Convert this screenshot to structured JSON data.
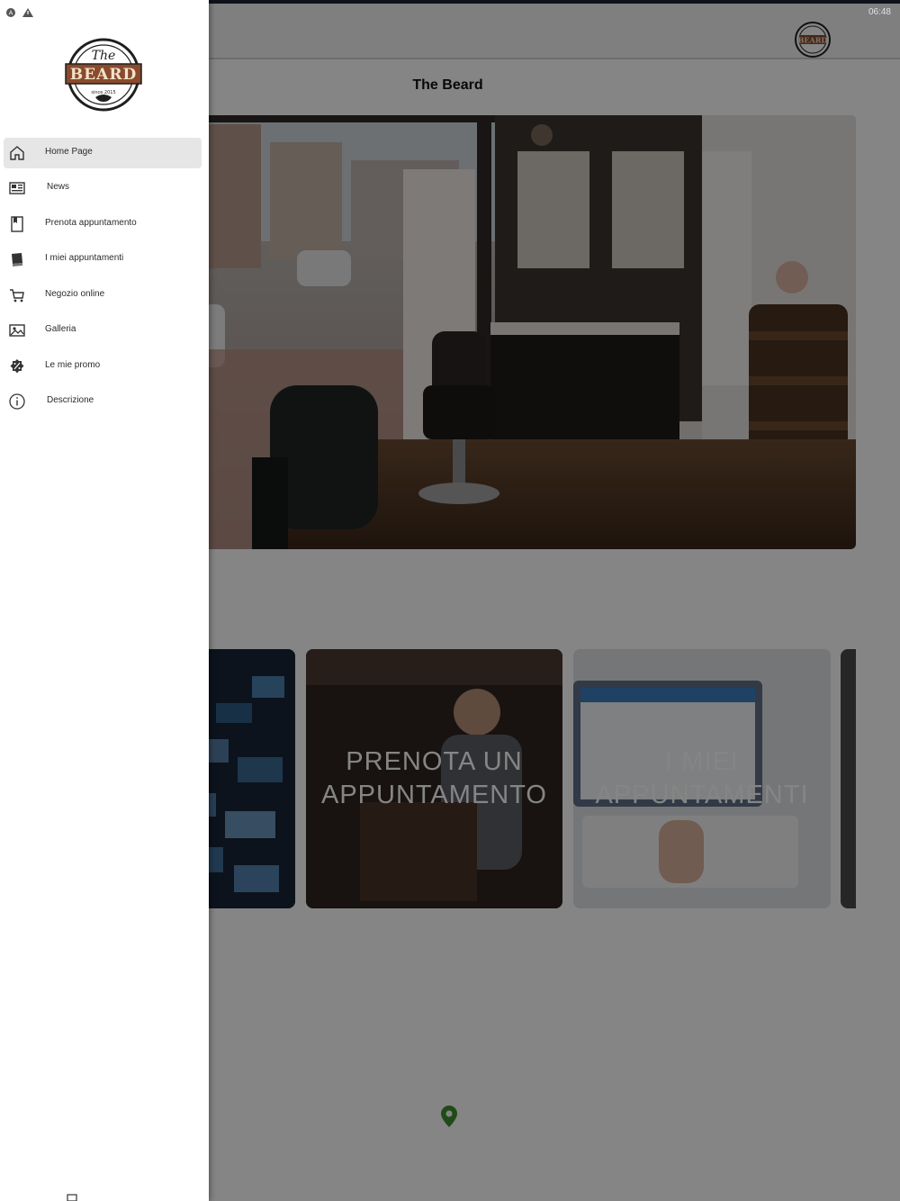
{
  "app": {
    "title": "The Beard",
    "clock": "06:48"
  },
  "drawer": {
    "logo": {
      "line1": "The",
      "line2": "BEARD",
      "line3": "since 2015"
    },
    "items": [
      {
        "label": "Home Page",
        "icon": "home-icon",
        "active": true
      },
      {
        "label": "News",
        "icon": "newspaper-icon",
        "active": false
      },
      {
        "label": "Prenota appuntamento",
        "icon": "bookmark-icon",
        "active": false
      },
      {
        "label": "I miei appuntamenti",
        "icon": "book-icon",
        "active": false
      },
      {
        "label": "Negozio online",
        "icon": "cart-icon",
        "active": false
      },
      {
        "label": "Galleria",
        "icon": "image-icon",
        "active": false
      },
      {
        "label": "Le mie promo",
        "icon": "badge-percent-icon",
        "active": false
      },
      {
        "label": "Descrizione",
        "icon": "info-icon",
        "active": false
      }
    ]
  },
  "tiles": [
    {
      "label": ""
    },
    {
      "label": "PRENOTA UN APPUNTAMENTO"
    },
    {
      "label": "I MIEI APPUNTAMENTI"
    },
    {
      "label": ""
    }
  ],
  "colors": {
    "overlay": "#000000",
    "drawer_bg": "#ffffff",
    "active_item": "#e6e6e6",
    "logo_brown": "#8a4a2c",
    "pin_green": "#3f8f2f"
  }
}
